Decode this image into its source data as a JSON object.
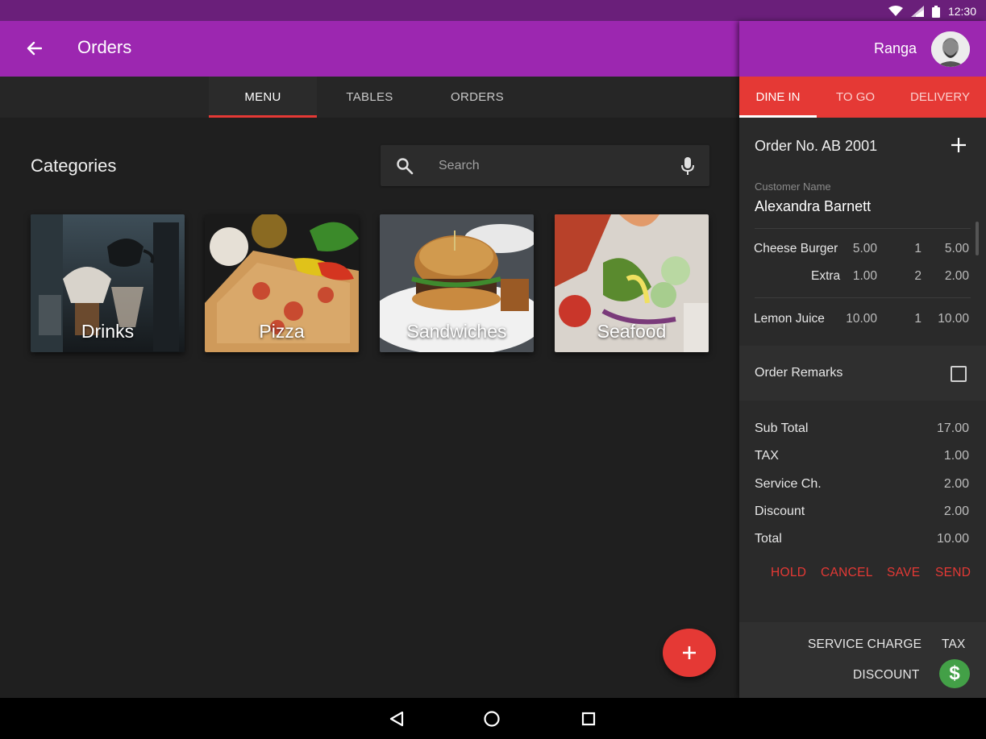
{
  "status_bar": {
    "time": "12:30"
  },
  "app_bar": {
    "title": "Orders"
  },
  "tabs": [
    {
      "label": "MENU",
      "active": true
    },
    {
      "label": "TABLES",
      "active": false
    },
    {
      "label": "ORDERS",
      "active": false
    }
  ],
  "categories": {
    "title": "Categories",
    "items": [
      {
        "label": "Drinks"
      },
      {
        "label": "Pizza"
      },
      {
        "label": "Sandwiches"
      },
      {
        "label": "Seafood"
      }
    ]
  },
  "search": {
    "placeholder": "Search"
  },
  "panel": {
    "user_name": "Ranga",
    "order_types": [
      {
        "label": "DINE IN",
        "active": true
      },
      {
        "label": "TO GO",
        "active": false
      },
      {
        "label": "DELIVERY",
        "active": false
      }
    ],
    "order_no": "Order No. AB 2001",
    "customer_label": "Customer Name",
    "customer_name": "Alexandra Barnett",
    "items": [
      {
        "name": "Cheese Burger",
        "price": "5.00",
        "qty": "1",
        "total": "5.00"
      },
      {
        "name": "Extra",
        "price": "1.00",
        "qty": "2",
        "total": "2.00"
      },
      {
        "name": "Lemon Juice",
        "price": "10.00",
        "qty": "1",
        "total": "10.00"
      }
    ],
    "remarks_label": "Order Remarks",
    "summary": [
      {
        "label": "Sub Total",
        "value": "17.00"
      },
      {
        "label": "TAX",
        "value": "1.00"
      },
      {
        "label": "Service Ch.",
        "value": "2.00"
      },
      {
        "label": "Discount",
        "value": "2.00"
      },
      {
        "label": "Total",
        "value": "10.00"
      }
    ],
    "actions": {
      "hold": "HOLD",
      "cancel": "CANCEL",
      "save": "SAVE",
      "send": "SEND"
    },
    "footer": {
      "service_charge": "SERVICE CHARGE",
      "tax": "TAX",
      "discount": "DISCOUNT",
      "dollar": "$"
    }
  },
  "colors": {
    "primary": "#9c27b0",
    "accent": "#e53935",
    "success": "#43a047",
    "background": "#1f1f1f"
  }
}
